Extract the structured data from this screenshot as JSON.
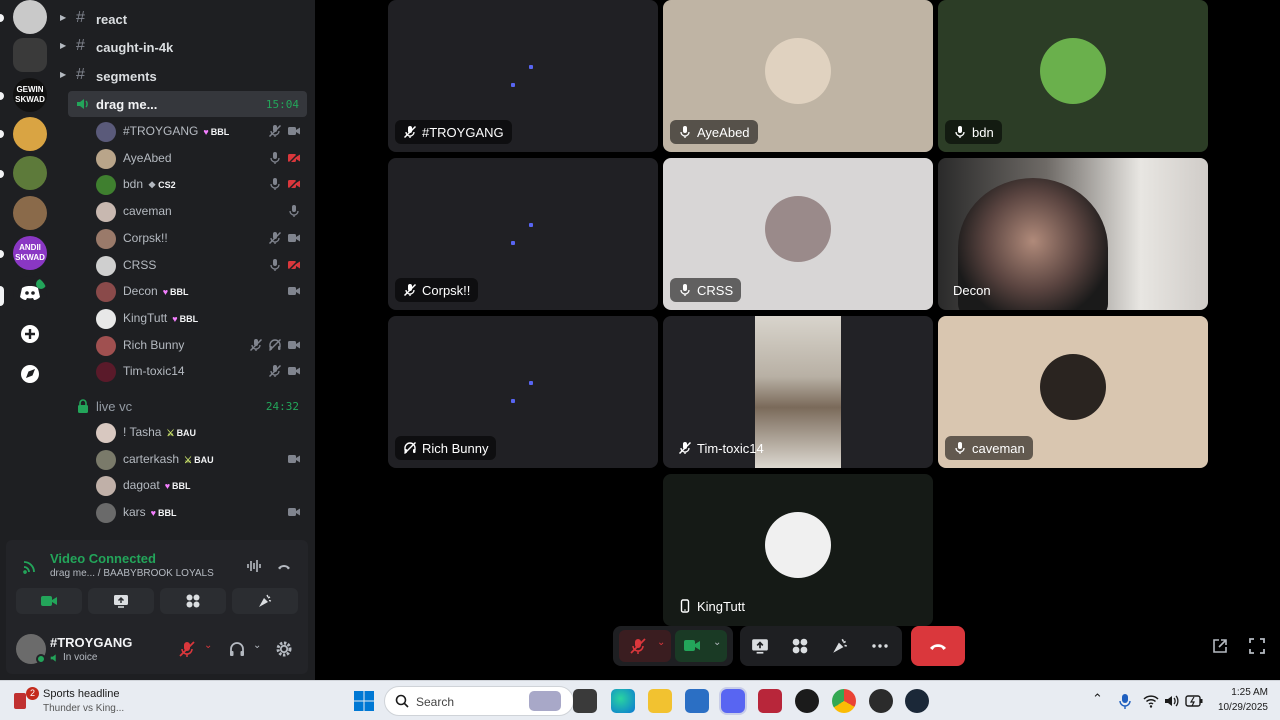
{
  "sidebar": {
    "text_channels": [
      {
        "name": "react"
      },
      {
        "name": "caught-in-4k"
      },
      {
        "name": "segments"
      }
    ],
    "active_voice": {
      "name": "drag me...",
      "timer": "15:04",
      "members": [
        {
          "name": "#TROYGANG",
          "tag": "BBL",
          "tag_icon": "heart"
        },
        {
          "name": "AyeAbed",
          "tag": "",
          "tag_icon": ""
        },
        {
          "name": "bdn",
          "tag": "CS2",
          "tag_icon": "diamond"
        },
        {
          "name": "caveman",
          "tag": "",
          "tag_icon": ""
        },
        {
          "name": "Corpsk!!",
          "tag": "",
          "tag_icon": ""
        },
        {
          "name": "CRSS",
          "tag": "",
          "tag_icon": ""
        },
        {
          "name": "Decon",
          "tag": "BBL",
          "tag_icon": "heart"
        },
        {
          "name": "KingTutt",
          "tag": "BBL",
          "tag_icon": "heart"
        },
        {
          "name": "Rich Bunny",
          "tag": "",
          "tag_icon": ""
        },
        {
          "name": "Tim-toxic14",
          "tag": "",
          "tag_icon": ""
        }
      ]
    },
    "live_vc": {
      "name": "live vc",
      "timer": "24:32",
      "members": [
        {
          "name": "! Tasha",
          "tag": "BAU",
          "tag_icon": "sword"
        },
        {
          "name": "carterkash",
          "tag": "BAU",
          "tag_icon": "sword"
        },
        {
          "name": "dagoat",
          "tag": "BBL",
          "tag_icon": "heart"
        },
        {
          "name": "kars",
          "tag": "BBL",
          "tag_icon": "heart"
        }
      ]
    }
  },
  "voice_panel": {
    "status": "Video Connected",
    "channel_path": "drag me... / BAABYBROOK LOYALS"
  },
  "user_panel": {
    "username": "#TROYGANG",
    "status": "In voice"
  },
  "tiles": [
    {
      "name": "#TROYGANG",
      "icon": "mic-muted-icon",
      "style": "dark"
    },
    {
      "name": "AyeAbed",
      "icon": "mic-icon",
      "style": "beige"
    },
    {
      "name": "bdn",
      "icon": "mic-icon",
      "style": "green"
    },
    {
      "name": "Corpsk!!",
      "icon": "mic-muted-icon",
      "style": "dark"
    },
    {
      "name": "CRSS",
      "icon": "mic-icon",
      "style": "light"
    },
    {
      "name": "Decon",
      "icon": "",
      "style": "camera"
    },
    {
      "name": "Rich Bunny",
      "icon": "deafened-icon",
      "style": "dark"
    },
    {
      "name": "Tim-toxic14",
      "icon": "mic-muted-icon",
      "style": "video"
    },
    {
      "name": "caveman",
      "icon": "mic-icon",
      "style": "tan"
    },
    {
      "name": "KingTutt",
      "icon": "phone-icon",
      "style": "darkgreen"
    }
  ],
  "taskbar": {
    "widget_badge": "2",
    "widget_title": "Sports headline",
    "widget_subtitle": "Thunder vs King...",
    "search_placeholder": "Search",
    "time": "1:25 AM",
    "date": "10/29/2025"
  },
  "colors": {
    "accent": "#5865f2",
    "green": "#23a55a",
    "danger": "#da373c",
    "sidebar_bg": "#1e1f22"
  }
}
